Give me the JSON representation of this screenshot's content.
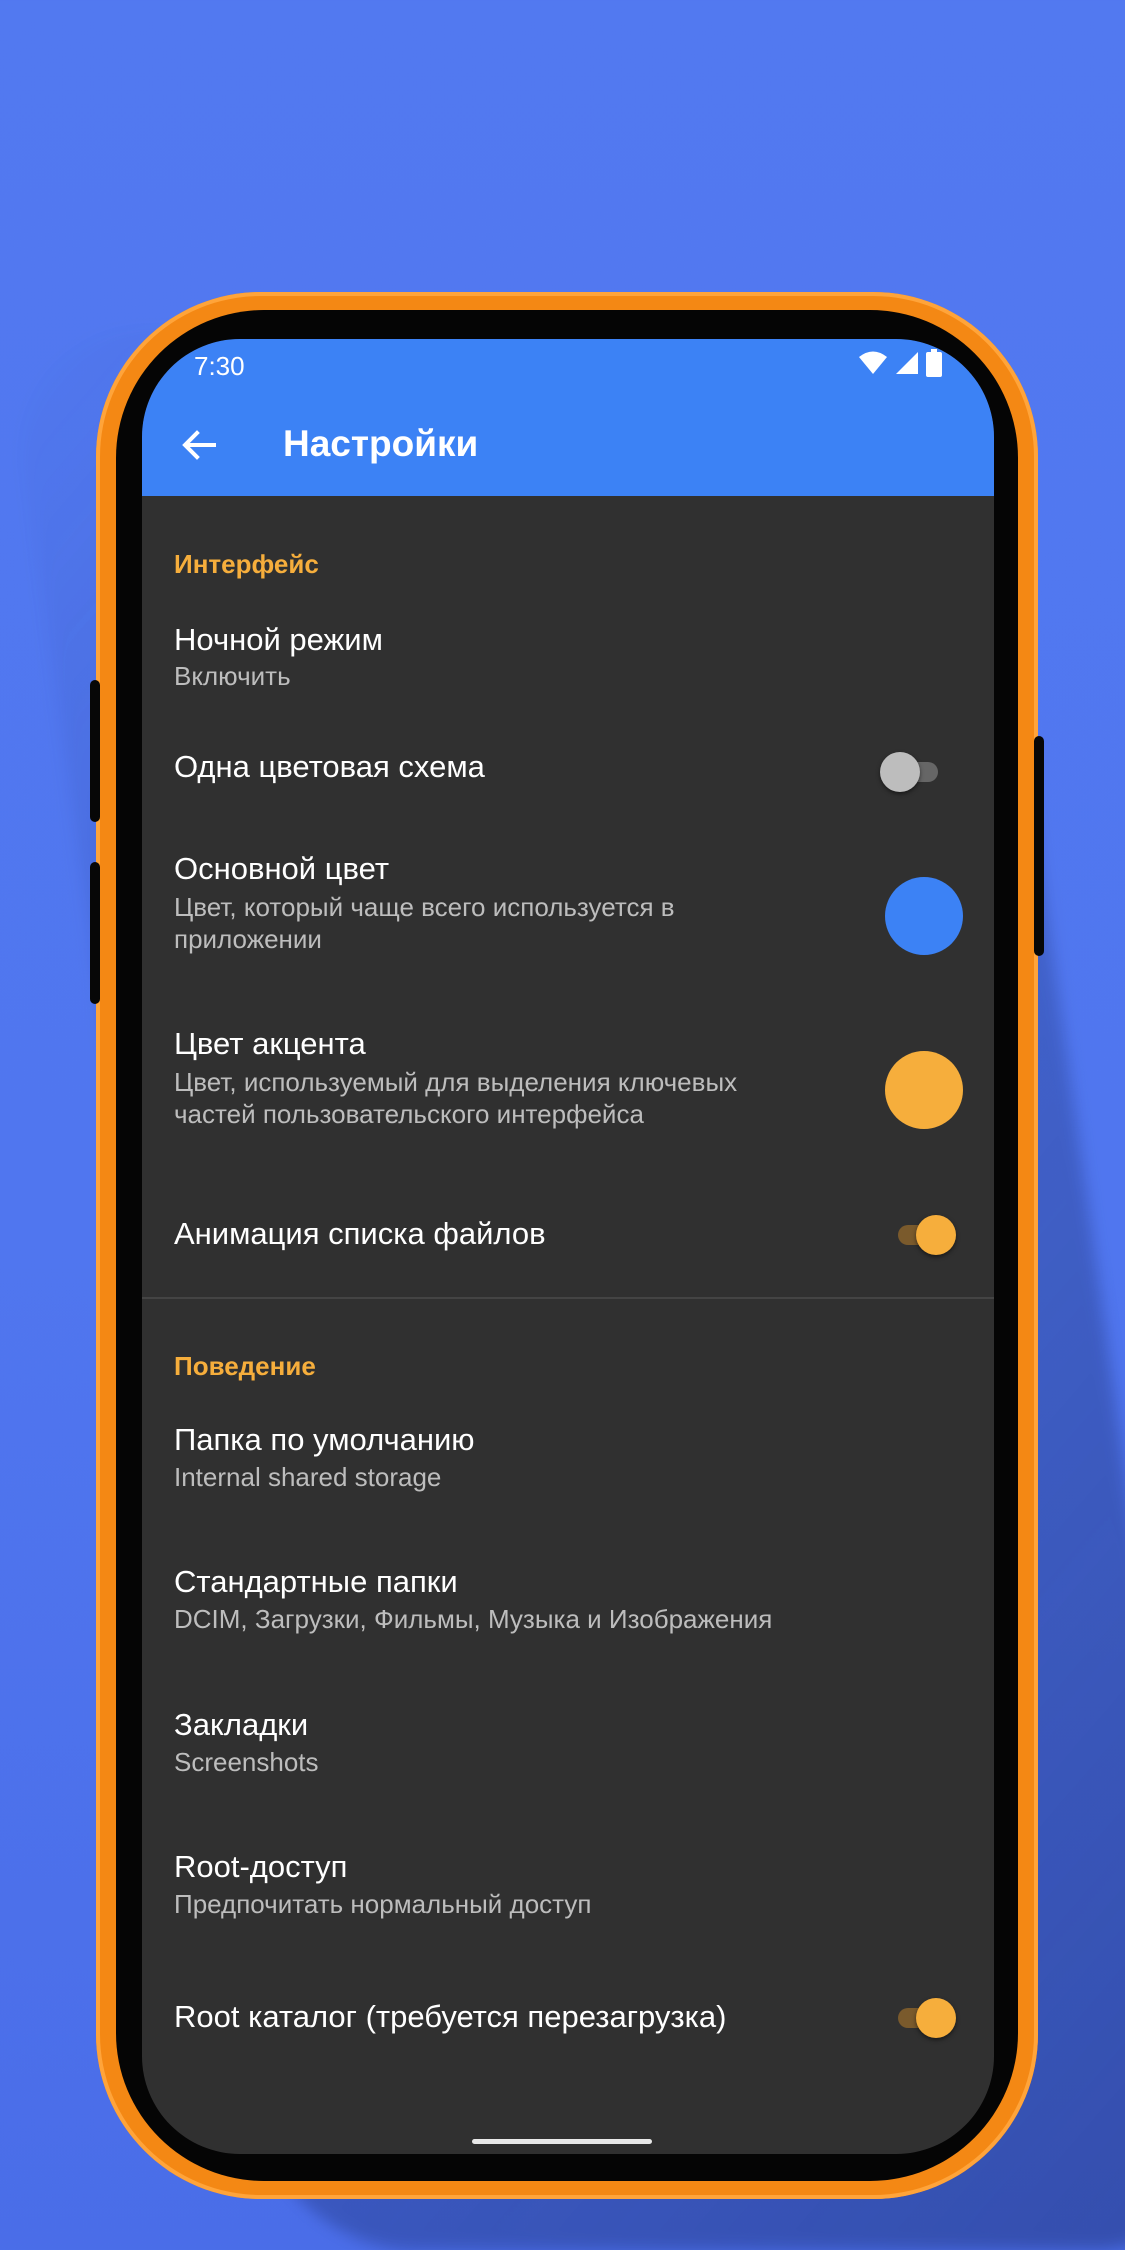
{
  "status_bar": {
    "time": "7:30",
    "icons": [
      "wifi-icon",
      "signal-icon",
      "battery-icon"
    ]
  },
  "app_bar": {
    "title": "Настройки",
    "back_icon": "back-arrow-icon"
  },
  "colors": {
    "background": "#5279f0",
    "phone_frame": "#f48814",
    "app_bar": "#3c82f5",
    "screen_bg": "#303030",
    "section_header": "#f6ae3c",
    "primary_color": "#3c82f5",
    "accent_color": "#f6ae3c"
  },
  "sections": {
    "interface": {
      "header": "Интерфейс",
      "night_mode": {
        "title": "Ночной режим",
        "subtitle": "Включить"
      },
      "single_color_scheme": {
        "title": "Одна цветовая схема",
        "enabled": false
      },
      "primary_color": {
        "title": "Основной цвет",
        "subtitle_line1": "Цвет, который чаще всего используется в",
        "subtitle_line2": "приложении"
      },
      "accent_color": {
        "title": "Цвет акцента",
        "subtitle_line1": "Цвет, используемый для выделения ключевых",
        "subtitle_line2": "частей пользовательского интерфейса"
      },
      "file_list_animation": {
        "title": "Анимация списка файлов",
        "enabled": true
      }
    },
    "behavior": {
      "header": "Поведение",
      "default_folder": {
        "title": "Папка по умолчанию",
        "subtitle": "Internal shared storage"
      },
      "standard_folders": {
        "title": "Стандартные папки",
        "subtitle": "DCIM, Загрузки, Фильмы, Музыка и Изображения"
      },
      "bookmarks": {
        "title": "Закладки",
        "subtitle": "Screenshots"
      },
      "root_access": {
        "title": "Root-доступ",
        "subtitle": "Предпочитать нормальный доступ"
      },
      "root_directory": {
        "title": "Root каталог (требуется перезагрузка)",
        "enabled": true
      }
    }
  }
}
